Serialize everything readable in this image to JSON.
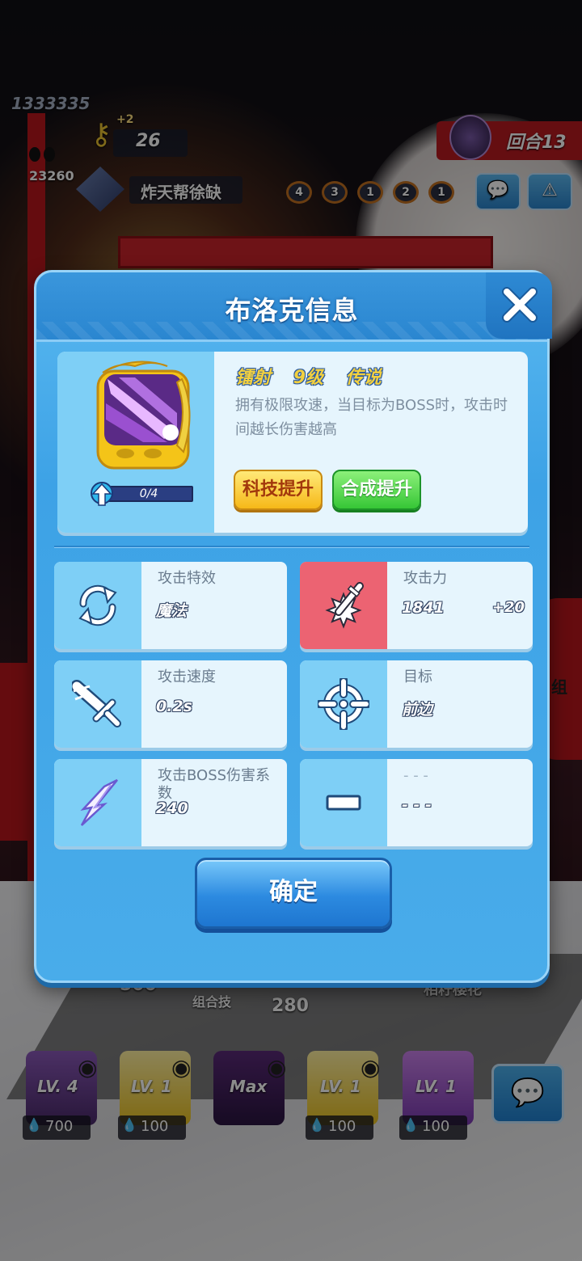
{
  "background": {
    "score": "1333335",
    "gold": "23260",
    "key_bonus": "+2",
    "key_count": "26",
    "player_name": "炸天帮徐缺",
    "bead_counts": [
      "4",
      "3",
      "1",
      "2",
      "1"
    ],
    "round": "回合13",
    "bottom_left_cost": "500",
    "combo_label": "组合技",
    "combo_cost": "280",
    "right_label": "相籽樱花",
    "side_label": "组",
    "cards": [
      {
        "level": "LV. 4",
        "cost": "700"
      },
      {
        "level": "LV. 1",
        "cost": "100"
      },
      {
        "level": "Max",
        "cost": ""
      },
      {
        "level": "LV. 1",
        "cost": "100"
      },
      {
        "level": "LV. 1",
        "cost": "100"
      }
    ]
  },
  "dialog": {
    "title": "布洛克信息",
    "tower": {
      "name": "镭射",
      "level": "9级",
      "rarity": "传说",
      "description": "拥有极限攻速，当目标为BOSS时，攻击时间越长伤害越高",
      "upgrade_progress": "0/4",
      "upgrade_fraction": 0
    },
    "tech_button": "科技提升",
    "merge_button": "合成提升",
    "stats": [
      {
        "label": "攻击特效",
        "value": "魔法",
        "bonus": "",
        "icon": "cycle-icon"
      },
      {
        "label": "攻击力",
        "value": "1841",
        "bonus": "+20",
        "icon": "attack-power-icon"
      },
      {
        "label": "攻击速度",
        "value": "0.2s",
        "bonus": "",
        "icon": "sword-icon"
      },
      {
        "label": "目标",
        "value": "前边",
        "bonus": "",
        "icon": "crosshair-icon"
      },
      {
        "label": "攻击BOSS伤害系数",
        "value": "240",
        "bonus": "",
        "icon": "lightning-icon"
      },
      {
        "label": "- - -",
        "value": "- - -",
        "bonus": "",
        "icon": "minus-icon"
      }
    ],
    "confirm_button": "确定"
  }
}
